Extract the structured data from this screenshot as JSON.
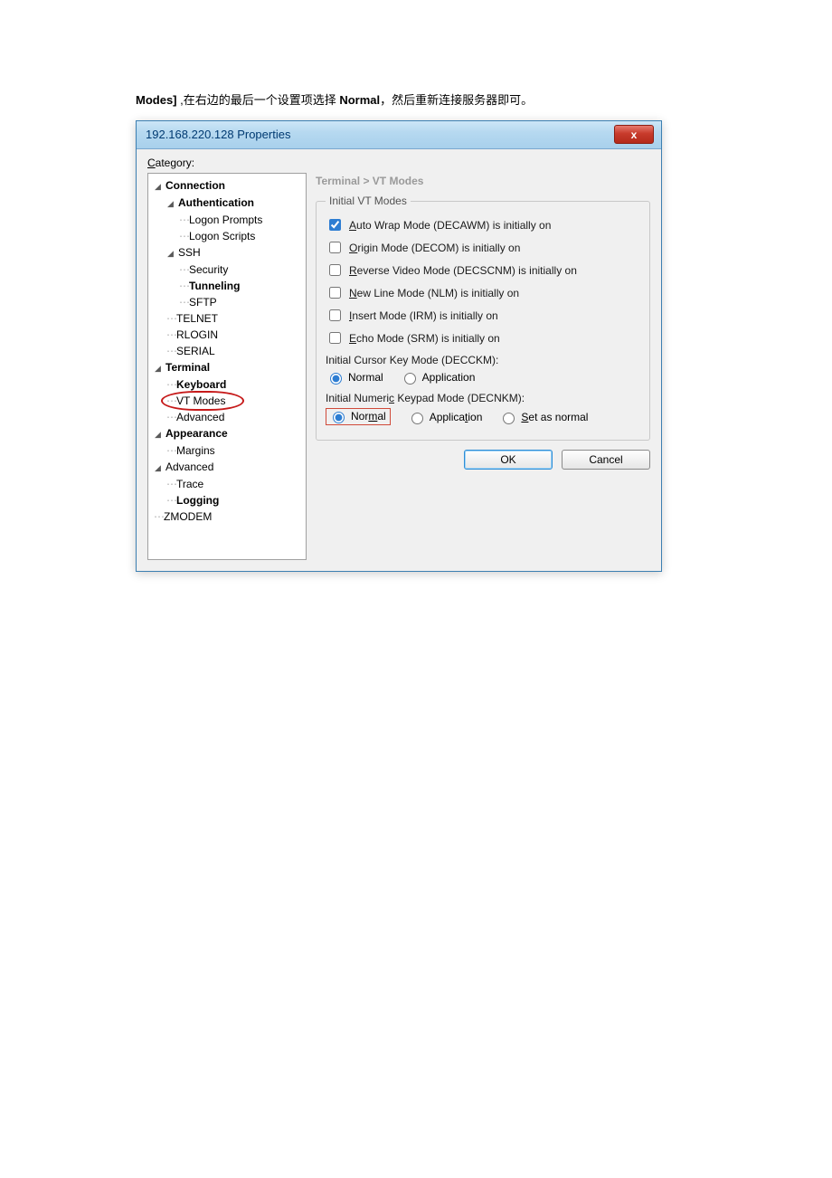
{
  "caption": {
    "prefix_bold": "Modes]",
    "middle": " ,在右边的最后一个设置项选择 ",
    "optname_bold": "Normal",
    "suffix": "，然后重新连接服务器即可。"
  },
  "dialog": {
    "title": "192.168.220.128 Properties",
    "close": "x",
    "category_label": "Category:"
  },
  "tree": {
    "connection": "Connection",
    "authentication": "Authentication",
    "logon_prompts": "Logon Prompts",
    "logon_scripts": "Logon Scripts",
    "ssh": "SSH",
    "security": "Security",
    "tunneling": "Tunneling",
    "sftp": "SFTP",
    "telnet": "TELNET",
    "rlogin": "RLOGIN",
    "serial": "SERIAL",
    "terminal": "Terminal",
    "keyboard": "Keyboard",
    "vt_modes": "VT Modes",
    "advanced": "Advanced",
    "appearance": "Appearance",
    "margins": "Margins",
    "advanced2": "Advanced",
    "trace": "Trace",
    "logging": "Logging",
    "zmodem": "ZMODEM"
  },
  "panel": {
    "breadcrumb": "Terminal > VT Modes",
    "group_title": "Initial VT Modes",
    "chk_autowrap_pre": "A",
    "chk_autowrap_rest": "uto Wrap Mode (DECAWM) is initially on",
    "chk_origin_pre": "O",
    "chk_origin_rest": "rigin Mode (DECOM) is initially on",
    "chk_reverse_pre": "R",
    "chk_reverse_rest": "everse Video Mode (DECSCNM) is initially on",
    "chk_newline_pre": "N",
    "chk_newline_rest": "ew Line Mode (NLM) is initially on",
    "chk_insert_pre": "I",
    "chk_insert_rest": "nsert Mode (IRM) is initially on",
    "chk_echo_pre": "E",
    "chk_echo_rest": "cho Mode (SRM) is initially on",
    "cursor_label": "Initial Cursor Key Mode (DECCKM):",
    "cursor_normal": "Normal",
    "cursor_app": "Application",
    "keypad_label_pre": "Initial Numeri",
    "keypad_label_u": "c",
    "keypad_label_post": " Keypad Mode (DECNKM):",
    "keypad_normal_pre": "Nor",
    "keypad_normal_u": "m",
    "keypad_normal_post": "al",
    "keypad_app_pre": "Applica",
    "keypad_app_u": "t",
    "keypad_app_post": "ion",
    "keypad_set_pre": "S",
    "keypad_set_rest": "et as normal"
  },
  "buttons": {
    "ok": "OK",
    "cancel": "Cancel"
  }
}
